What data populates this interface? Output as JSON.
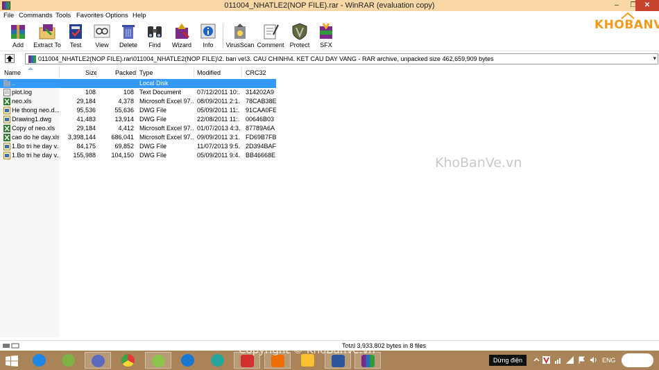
{
  "window": {
    "title": "011004_NHATLE2(NOP FILE).rar - WinRAR (evaluation copy)",
    "min_glyph": "–",
    "max_glyph": "❐",
    "close_glyph": "✕"
  },
  "menu": [
    "File",
    "Commands",
    "Tools",
    "Favorites",
    "Options",
    "Help"
  ],
  "toolbar": [
    {
      "label": "Add",
      "icon": "add-icon"
    },
    {
      "label": "Extract To",
      "icon": "extract-to-icon"
    },
    {
      "label": "Test",
      "icon": "test-icon"
    },
    {
      "label": "View",
      "icon": "view-icon"
    },
    {
      "label": "Delete",
      "icon": "delete-icon"
    },
    {
      "label": "Find",
      "icon": "find-icon"
    },
    {
      "label": "Wizard",
      "icon": "wizard-icon"
    },
    {
      "label": "Info",
      "icon": "info-icon"
    },
    {
      "label": "VirusScan",
      "icon": "virusscan-icon"
    },
    {
      "label": "Comment",
      "icon": "comment-icon"
    },
    {
      "label": "Protect",
      "icon": "protect-icon"
    },
    {
      "label": "SFX",
      "icon": "sfx-icon"
    }
  ],
  "logo": "KHOBANVE",
  "address": "011004_NHATLE2(NOP FILE).rar\\011004_NHATLE2(NOP FILE)\\2. ban ve\\3. CAU CHINH\\4. KET CAU DAY VANG - RAR archive, unpacked size 462,659,909 bytes",
  "columns": [
    "Name",
    "Size",
    "Packed",
    "Type",
    "Modified",
    "CRC32"
  ],
  "files": [
    {
      "name": "..",
      "size": "",
      "packed": "",
      "type": "Local Disk",
      "modified": "",
      "crc": "",
      "icon": "folder-up-icon",
      "selected": true
    },
    {
      "name": "plot.log",
      "size": "108",
      "packed": "108",
      "type": "Text Document",
      "modified": "07/12/2011 10:...",
      "crc": "314202A9",
      "icon": "text-file-icon"
    },
    {
      "name": "neo.xls",
      "size": "29,184",
      "packed": "4,378",
      "type": "Microsoft Excel 97...",
      "modified": "08/09/2011 2:1...",
      "crc": "78CAB38E",
      "icon": "excel-file-icon"
    },
    {
      "name": "He thong neo.d...",
      "size": "95,536",
      "packed": "55,636",
      "type": "DWG File",
      "modified": "05/09/2011 11:...",
      "crc": "91CAA0FE",
      "icon": "dwg-file-icon"
    },
    {
      "name": "Drawing1.dwg",
      "size": "41,483",
      "packed": "13,914",
      "type": "DWG File",
      "modified": "22/08/2011 11:...",
      "crc": "00646B03",
      "icon": "dwg-file-icon"
    },
    {
      "name": "Copy of neo.xls",
      "size": "29,184",
      "packed": "4,412",
      "type": "Microsoft Excel 97...",
      "modified": "01/07/2013 4:3...",
      "crc": "87789A6A",
      "icon": "excel-file-icon"
    },
    {
      "name": "cao do he day.xls",
      "size": "3,398,144",
      "packed": "686,041",
      "type": "Microsoft Excel 97...",
      "modified": "09/09/2011 3:1...",
      "crc": "FD69B7FB",
      "icon": "excel-file-icon"
    },
    {
      "name": "1.Bo tri he day v...",
      "size": "84,175",
      "packed": "69,852",
      "type": "DWG File",
      "modified": "11/07/2013 9:5...",
      "crc": "2D394BAF",
      "icon": "dwg-file-icon"
    },
    {
      "name": "1.Bo tri he day v...",
      "size": "155,988",
      "packed": "104,150",
      "type": "DWG File",
      "modified": "05/09/2011 9:4...",
      "crc": "BB46668E",
      "icon": "dwg-file-icon"
    }
  ],
  "watermark": "KhoBanVe.vn",
  "status": {
    "text": "Total 3,933,802 bytes in 8 files"
  },
  "taskbar": {
    "apps": [
      {
        "name": "start",
        "color": "#ffffff"
      },
      {
        "name": "internet-explorer",
        "color": "#1e88e5"
      },
      {
        "name": "utorrent",
        "color": "#7cb342"
      },
      {
        "name": "windows-explorer-old",
        "color": "#5c6bc0"
      },
      {
        "name": "chrome",
        "color": "#e53935"
      },
      {
        "name": "coccoc",
        "color": "#8bc34a"
      },
      {
        "name": "zalo",
        "color": "#1976d2"
      },
      {
        "name": "p-app",
        "color": "#26a69a"
      },
      {
        "name": "autocad",
        "color": "#d32f2f"
      },
      {
        "name": "foxit",
        "color": "#ef6c00"
      },
      {
        "name": "file-explorer",
        "color": "#fbc02d"
      },
      {
        "name": "word",
        "color": "#2b579a"
      },
      {
        "name": "winrar",
        "color": "#7b2b8a"
      }
    ],
    "copyright": "Copyright © KhoBanVe.vn",
    "tooltip": "Dừng điện",
    "lang": "ENG"
  }
}
